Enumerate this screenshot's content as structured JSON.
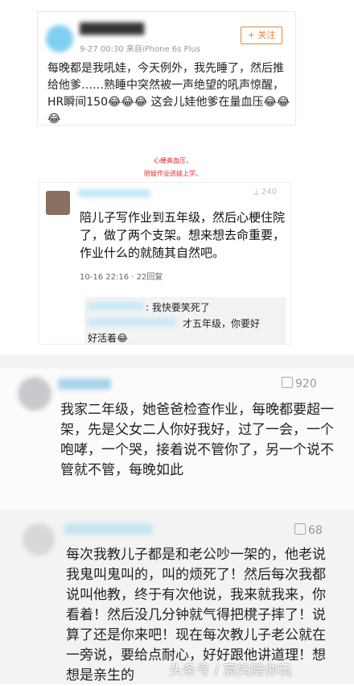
{
  "post1": {
    "meta": "9-27 00:30  来自iPhone 6s Plus",
    "follow_label": "+ 关注",
    "text": "每晚都是我吼娃，今天例外，我先睡了，然后推给他爹……熟睡中突然被一声绝望的吼声惊醒，HR瞬间150😂😂😂 这会儿娃他爹在量血压😂😂😂"
  },
  "caption": {
    "line1": "心梗高血压，",
    "line2": "陪娃作业送娃上学。"
  },
  "post2": {
    "count": "⟂ 240",
    "text": "陪儿子写作业到五年级，然后心梗住院了，做了两个支架。想来想去命重要，作业什么的就随其自然吧。",
    "meta": "10-16 22:16 ·   22回复",
    "reply1": ": 我快要笑死了",
    "reply2": "才五年级，你要好",
    "reply3": "好活着😂"
  },
  "comment1": {
    "likes": "920",
    "text": "我家二年级，她爸爸检查作业，每晚都要超一架，先是父女二人你好我好，过了一会，一个咆哮，一个哭，接着说不管你了，另一个说不管就不管，每晚如此"
  },
  "comment2": {
    "likes": "68",
    "text": "每次我教儿子都是和老公吵一架的，他老说我鬼叫鬼叫的，叫的烦死了！然后每次我都说叫他教，终于有次他说，我来就我来，你看着！然后没几分钟就气得把櫈子摔了！说算了还是你来吧！现在每次教儿子老公就在一旁说，要给点耐心，好好跟他讲道理！想想是亲生的"
  },
  "watermark": "头条号 / 宸妈陪你玩"
}
